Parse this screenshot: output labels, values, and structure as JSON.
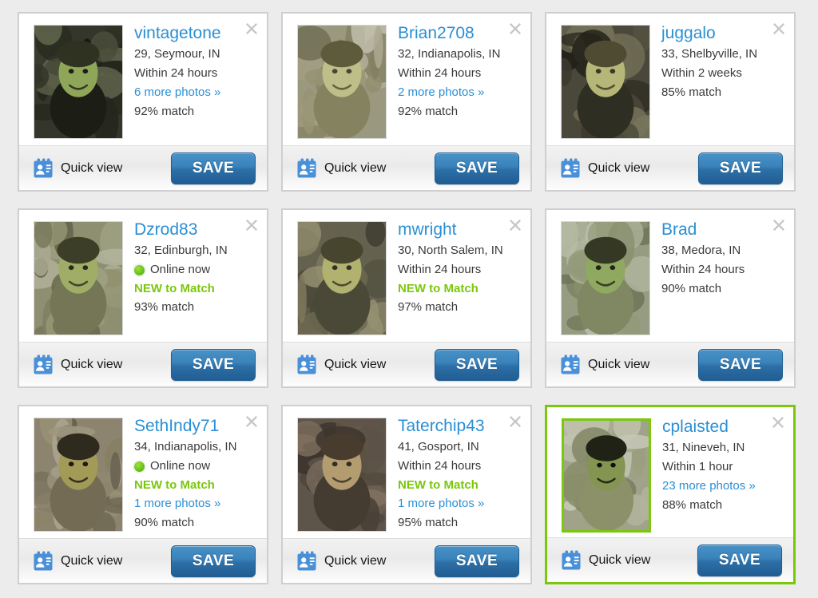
{
  "page": {
    "background_color": "#ececec",
    "card_border_color": "#cfcfcf",
    "accent_link_color": "#2a8fd4",
    "accent_green_color": "#7ac70c",
    "save_button_color": "#2c6fa6"
  },
  "labels": {
    "quick_view": "Quick view",
    "save": "SAVE",
    "close_icon": "close-icon",
    "quick_view_icon": "id-badge-icon",
    "online_dot_icon": "online-status-dot-icon"
  },
  "cards": [
    {
      "username": "vintagetone",
      "age_location": "29, Seymour, IN",
      "last_active": "Within 24 hours",
      "online": false,
      "online_text": "",
      "new_to_match": "",
      "more_photos": "6 more photos »",
      "match": "92% match",
      "highlighted": false,
      "photo_alt": "profile-photo-vintagetone"
    },
    {
      "username": "Brian2708",
      "age_location": "32, Indianapolis, IN",
      "last_active": "Within 24 hours",
      "online": false,
      "online_text": "",
      "new_to_match": "",
      "more_photos": "2 more photos »",
      "match": "92% match",
      "highlighted": false,
      "photo_alt": "profile-photo-Brian2708"
    },
    {
      "username": "juggalo",
      "age_location": "33, Shelbyville, IN",
      "last_active": "Within 2 weeks",
      "online": false,
      "online_text": "",
      "new_to_match": "",
      "more_photos": "",
      "match": "85% match",
      "highlighted": false,
      "photo_alt": "profile-photo-juggalo"
    },
    {
      "username": "Dzrod83",
      "age_location": "32, Edinburgh, IN",
      "last_active": "",
      "online": true,
      "online_text": "Online now",
      "new_to_match": "NEW to Match",
      "more_photos": "",
      "match": "93% match",
      "highlighted": false,
      "photo_alt": "profile-photo-Dzrod83"
    },
    {
      "username": "mwright",
      "age_location": "30, North Salem, IN",
      "last_active": "Within 24 hours",
      "online": false,
      "online_text": "",
      "new_to_match": "NEW to Match",
      "more_photos": "",
      "match": "97% match",
      "highlighted": false,
      "photo_alt": "profile-photo-mwright"
    },
    {
      "username": "Brad",
      "age_location": "38, Medora, IN",
      "last_active": "Within 24 hours",
      "online": false,
      "online_text": "",
      "new_to_match": "",
      "more_photos": "",
      "match": "90% match",
      "highlighted": false,
      "photo_alt": "profile-photo-Brad"
    },
    {
      "username": "SethIndy71",
      "age_location": "34, Indianapolis, IN",
      "last_active": "",
      "online": true,
      "online_text": "Online now",
      "new_to_match": "NEW to Match",
      "more_photos": "1 more photos »",
      "match": "90% match",
      "highlighted": false,
      "photo_alt": "profile-photo-SethIndy71"
    },
    {
      "username": "Taterchip43",
      "age_location": "41, Gosport, IN",
      "last_active": "Within 24 hours",
      "online": false,
      "online_text": "",
      "new_to_match": "NEW to Match",
      "more_photos": "1 more photos »",
      "match": "95% match",
      "highlighted": false,
      "photo_alt": "profile-photo-Taterchip43"
    },
    {
      "username": "cplaisted",
      "age_location": "31, Nineveh, IN",
      "last_active": "Within 1 hour",
      "online": false,
      "online_text": "",
      "new_to_match": "",
      "more_photos": "23 more photos »",
      "match": "88% match",
      "highlighted": true,
      "photo_alt": "profile-photo-cplaisted"
    }
  ]
}
